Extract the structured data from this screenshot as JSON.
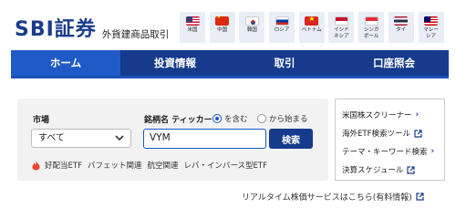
{
  "header": {
    "logo": "SBI証券",
    "subtitle": "外貨建商品取引",
    "flags": [
      {
        "label": "米国",
        "icon": "us-flag-icon",
        "cls": "f-us"
      },
      {
        "label": "中国",
        "icon": "china-flag-icon",
        "cls": "f-cn"
      },
      {
        "label": "韓国",
        "icon": "korea-flag-icon",
        "cls": "f-kr"
      },
      {
        "label": "ロシア",
        "icon": "russia-flag-icon",
        "cls": "f-ru"
      },
      {
        "label": "ベトナム",
        "icon": "vietnam-flag-icon",
        "cls": "f-vn"
      },
      {
        "label": "インド\nネシア",
        "icon": "indonesia-flag-icon",
        "cls": "f-id"
      },
      {
        "label": "シンガ\nポール",
        "icon": "singapore-flag-icon",
        "cls": "f-sg"
      },
      {
        "label": "タイ",
        "icon": "thailand-flag-icon",
        "cls": "f-th"
      },
      {
        "label": "マレー\nシア",
        "icon": "malaysia-flag-icon",
        "cls": "f-my"
      }
    ]
  },
  "nav": {
    "items": [
      "ホーム",
      "投資情報",
      "取引",
      "口座照会"
    ],
    "active_index": 0
  },
  "search": {
    "market_label": "市場",
    "market_value": "すべて",
    "name_label": "銘柄名 ティッカー",
    "radio_contains": "を含む",
    "radio_starts": "から始まる",
    "radio_selected": "contains",
    "input_value": "VYM",
    "button_label": "検索",
    "tags": [
      "好配当ETF",
      "バフェット関連",
      "航空関連",
      "レバ・インバース型ETF"
    ]
  },
  "links": {
    "items": [
      {
        "label": "米国株スクリーナー",
        "kind": "arrow"
      },
      {
        "label": "海外ETF検索ツール",
        "kind": "external"
      },
      {
        "label": "テーマ・キーワード検索",
        "kind": "arrow"
      },
      {
        "label": "決算スケジュール",
        "kind": "external"
      }
    ]
  },
  "footer": {
    "realtime_label": "リアルタイム株価サービスはこちら(有料情報)"
  },
  "colors": {
    "brand_navy": "#163a8c",
    "nav_active": "#1f5bc6",
    "accent_blue": "#1a56c8",
    "fire_red": "#e8452c"
  }
}
